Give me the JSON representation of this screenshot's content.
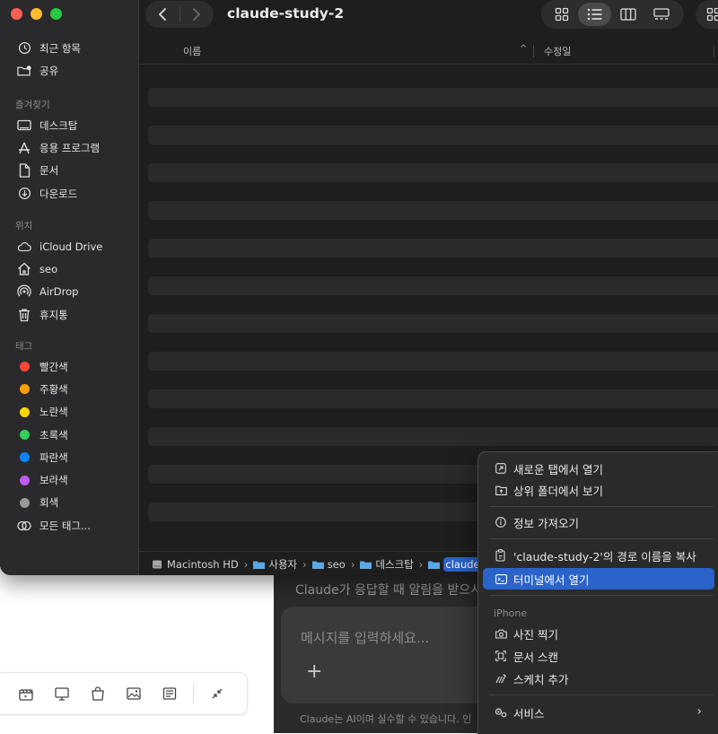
{
  "finder": {
    "title": "claude-study-2",
    "sidebar": {
      "recents": [
        {
          "label": "최근 항목",
          "icon": "clock-icon"
        },
        {
          "label": "공유",
          "icon": "shared-folder-icon"
        }
      ],
      "favorites_heading": "즐겨찾기",
      "favorites": [
        {
          "label": "데스크탑",
          "icon": "desktop-icon"
        },
        {
          "label": "응용 프로그램",
          "icon": "applications-icon"
        },
        {
          "label": "문서",
          "icon": "document-icon"
        },
        {
          "label": "다운로드",
          "icon": "download-icon"
        }
      ],
      "locations_heading": "위치",
      "locations": [
        {
          "label": "iCloud Drive",
          "icon": "cloud-icon"
        },
        {
          "label": "seo",
          "icon": "home-icon"
        },
        {
          "label": "AirDrop",
          "icon": "airdrop-icon"
        },
        {
          "label": "휴지통",
          "icon": "trash-icon"
        }
      ],
      "tags_heading": "태그",
      "tags": [
        {
          "label": "빨간색",
          "color": "#ff453a"
        },
        {
          "label": "주황색",
          "color": "#ff9f0a"
        },
        {
          "label": "노란색",
          "color": "#ffd60a"
        },
        {
          "label": "초록색",
          "color": "#30d158"
        },
        {
          "label": "파란색",
          "color": "#0a84ff"
        },
        {
          "label": "보라색",
          "color": "#bf5af2"
        },
        {
          "label": "회색",
          "color": "#98989d"
        }
      ],
      "all_tags": "모든 태그..."
    },
    "columns": {
      "name": "이름",
      "modified": "수정일"
    },
    "path": [
      {
        "label": "Macintosh HD"
      },
      {
        "label": "사용자"
      },
      {
        "label": "seo"
      },
      {
        "label": "데스크탑"
      },
      {
        "label": "claude"
      }
    ],
    "path_separator": "›"
  },
  "context_menu": {
    "items_group1": [
      {
        "label": "새로운 탭에서 열기",
        "icon": "new-tab-icon"
      },
      {
        "label": "상위 폴더에서 보기",
        "icon": "enclosing-folder-icon"
      }
    ],
    "get_info": {
      "label": "정보 가져오기",
      "icon": "info-icon"
    },
    "copy_path": {
      "label": "'claude-study-2'의 경로 이름을 복사",
      "icon": "copy-path-icon"
    },
    "open_terminal": {
      "label": "터미널에서 열기",
      "icon": "terminal-icon"
    },
    "iphone_heading": "iPhone",
    "iphone_items": [
      {
        "label": "사진 찍기",
        "icon": "camera-icon"
      },
      {
        "label": "문서 스캔",
        "icon": "scan-icon"
      },
      {
        "label": "스케치 추가",
        "icon": "sketch-icon"
      }
    ],
    "services": {
      "label": "서비스",
      "icon": "services-icon",
      "arrow": "›"
    }
  },
  "claude_app": {
    "notify_text": "Claude가 응답할 때 알림을 받으시",
    "input_placeholder": "메시지를 입력하세요...",
    "plus": "+",
    "disclaimer": "Claude는 AI이며 실수할 수 있습니다. 인"
  }
}
